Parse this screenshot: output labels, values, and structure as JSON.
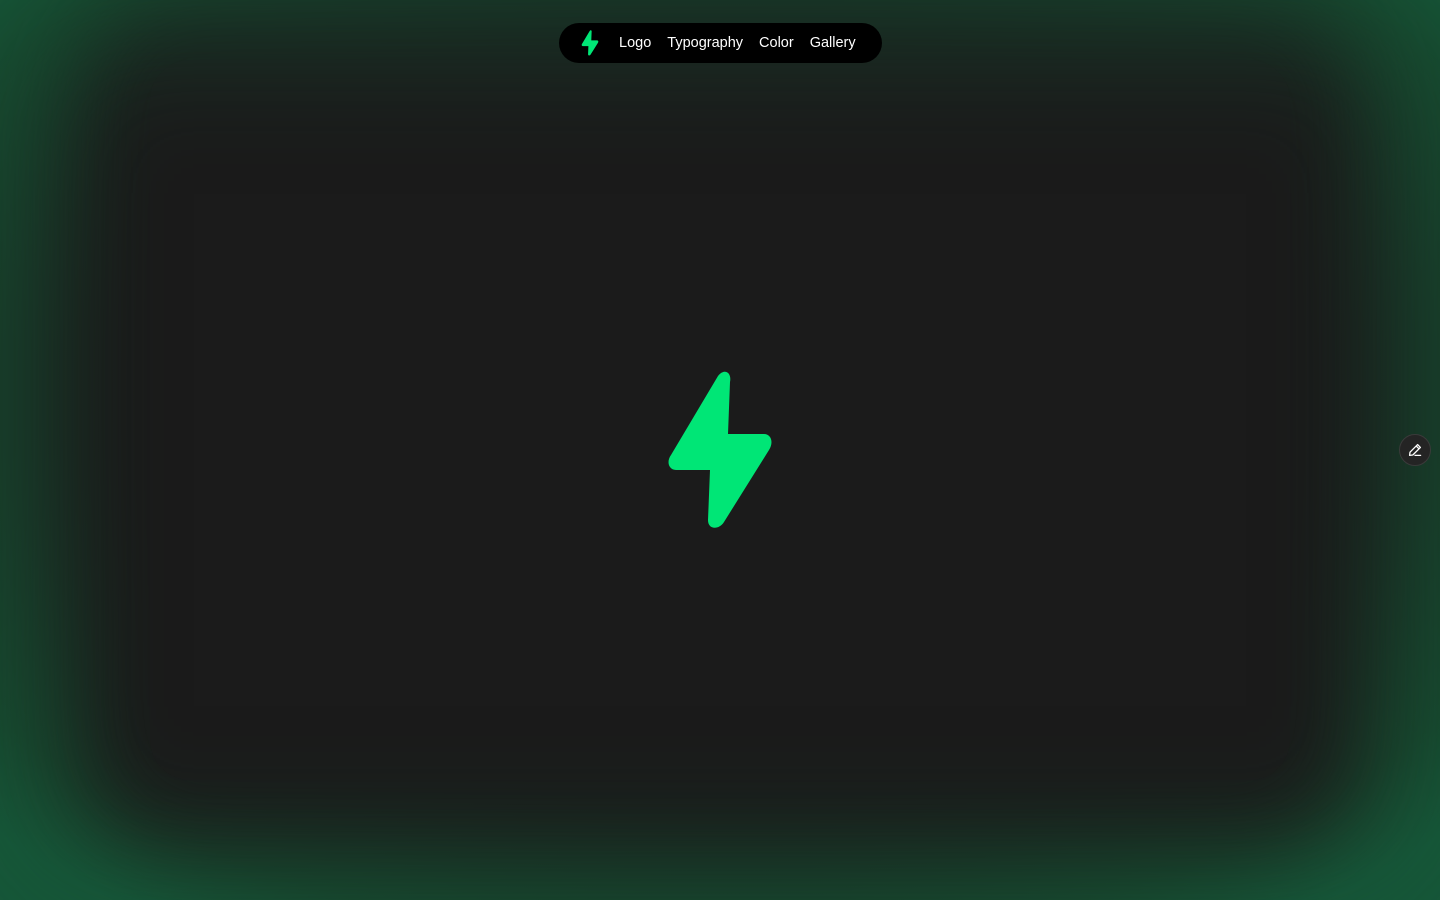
{
  "nav": {
    "logo_icon": "lightning-bolt-icon",
    "links": [
      {
        "label": "Logo"
      },
      {
        "label": "Typography"
      },
      {
        "label": "Color"
      },
      {
        "label": "Gallery"
      }
    ]
  },
  "hero": {
    "logo_icon": "lightning-bolt-icon"
  },
  "edit_button": {
    "icon": "pencil-icon"
  },
  "colors": {
    "brand_green": "#00E676",
    "background": "#1B1B1B",
    "frame_green": "#17573A",
    "nav_background": "#000000",
    "nav_text": "#FFFFFF"
  }
}
